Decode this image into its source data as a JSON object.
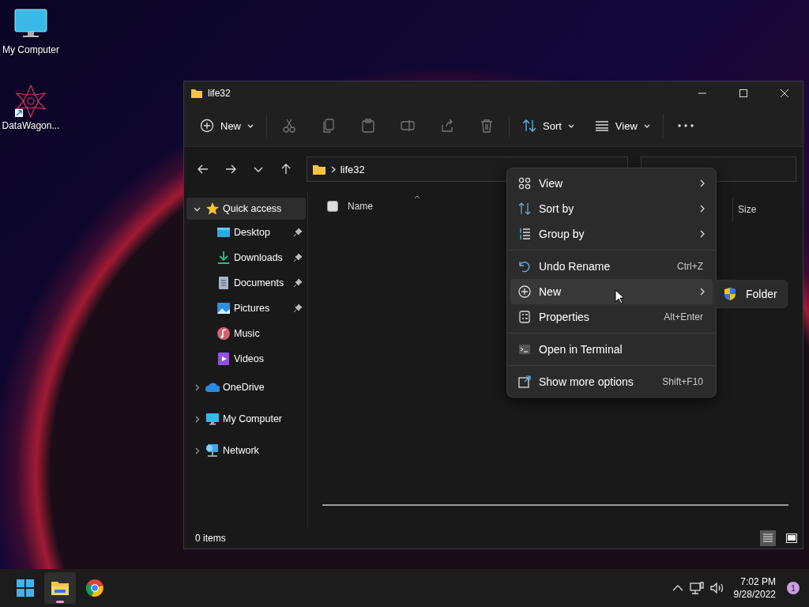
{
  "desktop_icons": [
    {
      "label": "My Computer",
      "kind": "computer"
    },
    {
      "label": "DataWagon...",
      "kind": "shortcut"
    }
  ],
  "window": {
    "title": "life32",
    "toolbar": {
      "new_label": "New",
      "sort_label": "Sort",
      "view_label": "View",
      "actions": [
        {
          "kind": "cut",
          "disabled": true
        },
        {
          "kind": "copy",
          "disabled": true
        },
        {
          "kind": "paste",
          "disabled": true
        },
        {
          "kind": "rename",
          "disabled": true
        },
        {
          "kind": "share",
          "disabled": true
        },
        {
          "kind": "delete",
          "disabled": true
        }
      ]
    },
    "address": {
      "path": "life32"
    },
    "sidebar": {
      "items": [
        {
          "label": "Quick access",
          "kind": "star",
          "expanded": true,
          "selected": true,
          "children": [
            {
              "label": "Desktop",
              "kind": "desktop",
              "pinned": true
            },
            {
              "label": "Downloads",
              "kind": "downloads",
              "pinned": true
            },
            {
              "label": "Documents",
              "kind": "documents",
              "pinned": true
            },
            {
              "label": "Pictures",
              "kind": "pictures",
              "pinned": true
            },
            {
              "label": "Music",
              "kind": "music",
              "pinned": false
            },
            {
              "label": "Videos",
              "kind": "videos",
              "pinned": false
            }
          ]
        },
        {
          "label": "OneDrive",
          "kind": "cloud",
          "expanded": false,
          "selected": false
        },
        {
          "label": "My Computer",
          "kind": "computer",
          "expanded": false,
          "selected": false
        },
        {
          "label": "Network",
          "kind": "network",
          "expanded": false,
          "selected": false
        }
      ]
    },
    "select_all": {
      "checked": false
    },
    "columns": [
      {
        "label": "Name",
        "sorted": true
      },
      {
        "label": "Size",
        "sorted": false
      }
    ],
    "status_bar": {
      "text": "0 items",
      "views": [
        {
          "kind": "details",
          "selected": true
        },
        {
          "kind": "tiles",
          "selected": false
        }
      ]
    }
  },
  "context_menu": {
    "groups": [
      [
        {
          "label": "View",
          "kind": "view",
          "submenu": true,
          "selected": false
        },
        {
          "label": "Sort by",
          "kind": "sort",
          "submenu": true,
          "selected": false
        },
        {
          "label": "Group by",
          "kind": "group",
          "submenu": true,
          "selected": false
        }
      ],
      [
        {
          "label": "Undo Rename",
          "kind": "undo",
          "shortcut": "Ctrl+Z",
          "selected": false
        },
        {
          "label": "New",
          "kind": "new",
          "submenu": true,
          "selected": true
        },
        {
          "label": "Properties",
          "kind": "properties",
          "shortcut": "Alt+Enter",
          "selected": false
        }
      ],
      [
        {
          "label": "Open in Terminal",
          "kind": "terminal",
          "selected": false
        }
      ],
      [
        {
          "label": "Show more options",
          "kind": "more",
          "shortcut": "Shift+F10",
          "selected": false
        }
      ]
    ]
  },
  "submenu": {
    "items": [
      {
        "label": "Folder",
        "kind": "shield"
      }
    ]
  },
  "taskbar": {
    "apps": [
      {
        "kind": "start",
        "selected": false
      },
      {
        "kind": "explorer",
        "selected": true
      },
      {
        "kind": "browser",
        "selected": false
      }
    ],
    "time": "7:02 PM",
    "date": "9/28/2022",
    "notifications": "1"
  }
}
